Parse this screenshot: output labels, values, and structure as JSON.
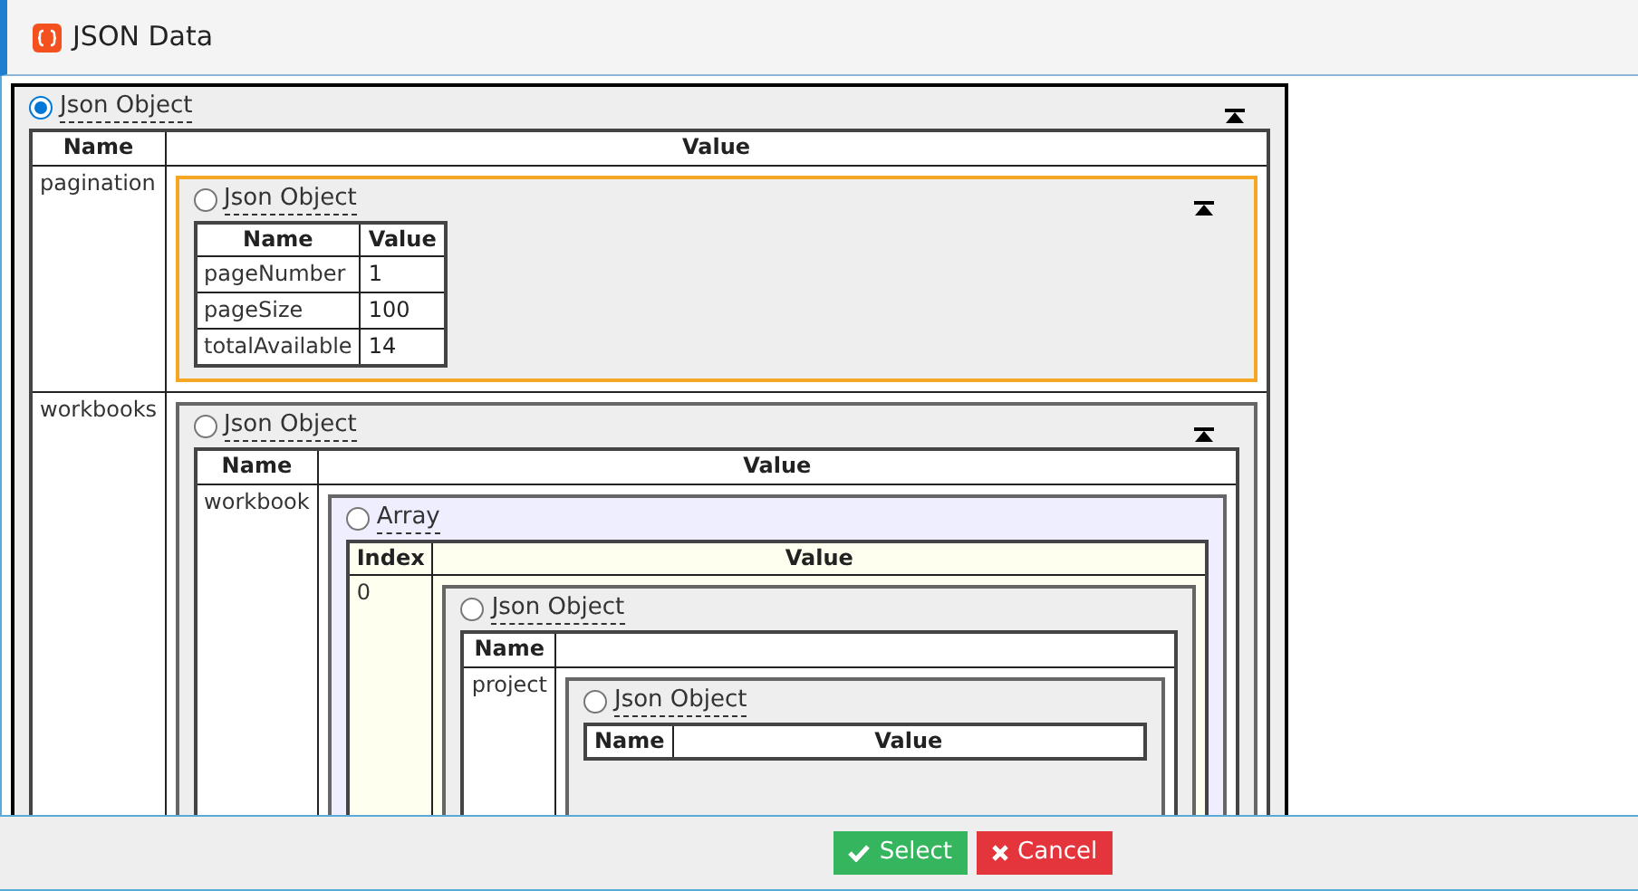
{
  "window": {
    "title": "JSON Data"
  },
  "tree": {
    "kind": "object",
    "label": "Json Object",
    "selected": true,
    "highlighted": false,
    "collapsible": true,
    "headers": [
      "Name",
      "Value"
    ],
    "rows": [
      {
        "name": "pagination",
        "child": {
          "kind": "object",
          "label": "Json Object",
          "selected": false,
          "highlighted": true,
          "collapsible": true,
          "headers": [
            "Name",
            "Value"
          ],
          "rows": [
            {
              "name": "pageNumber",
              "value": "1"
            },
            {
              "name": "pageSize",
              "value": "100"
            },
            {
              "name": "totalAvailable",
              "value": "14"
            }
          ]
        }
      },
      {
        "name": "workbooks",
        "child": {
          "kind": "object",
          "label": "Json Object",
          "selected": false,
          "highlighted": false,
          "collapsible": true,
          "headers": [
            "Name",
            "Value"
          ],
          "rows": [
            {
              "name": "workbook",
              "child": {
                "kind": "array",
                "label": "Array",
                "selected": false,
                "highlighted": false,
                "collapsible": false,
                "headers": [
                  "Index",
                  "Value"
                ],
                "rows": [
                  {
                    "name": "0",
                    "child": {
                      "kind": "object",
                      "label": "Json Object",
                      "selected": false,
                      "highlighted": false,
                      "collapsible": false,
                      "headers": [
                        "Name"
                      ],
                      "rows": [
                        {
                          "name": "project",
                          "child": {
                            "kind": "object",
                            "label": "Json Object",
                            "selected": false,
                            "highlighted": false,
                            "collapsible": false,
                            "headers": [
                              "Name",
                              "Value"
                            ]
                          }
                        }
                      ]
                    }
                  }
                ]
              }
            }
          ]
        }
      }
    ]
  },
  "buttons": [
    {
      "kind": "select",
      "label": "Select"
    },
    {
      "kind": "cancel",
      "label": "Cancel"
    }
  ]
}
